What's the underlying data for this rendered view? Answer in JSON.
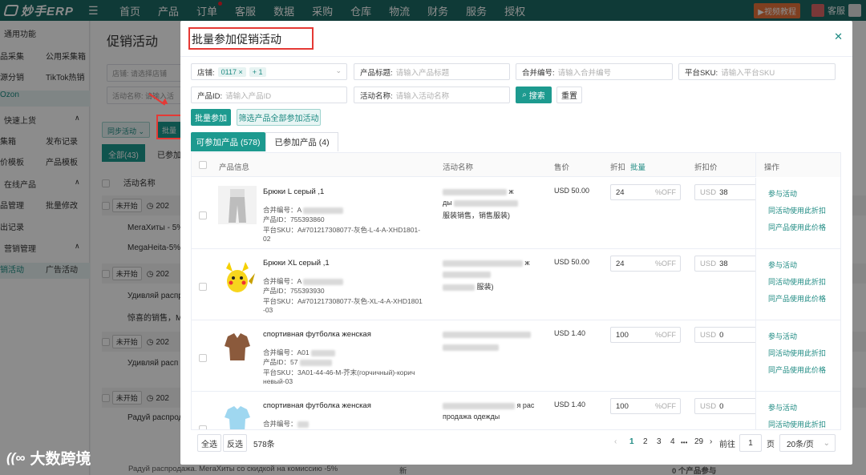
{
  "nav": {
    "logo": "妙手ERP",
    "items": [
      "首页",
      "产品",
      "订单",
      "客服",
      "数据",
      "采购",
      "仓库",
      "物流",
      "财务",
      "服务",
      "授权"
    ],
    "tutorial": "视频教程",
    "service": "客服"
  },
  "sidebar": {
    "rows": [
      {
        "a": "通用功能",
        "b": ""
      },
      {
        "a": "品采集",
        "b": "公用采集箱"
      },
      {
        "a": "源分销",
        "b": "TikTok热销"
      },
      {
        "a": "Ozon",
        "b": ""
      },
      {
        "a": "快速上货",
        "b": ""
      },
      {
        "a": "集箱",
        "b": "发布记录"
      },
      {
        "a": "价模板",
        "b": "产品模板"
      },
      {
        "a": "在线产品",
        "b": ""
      },
      {
        "a": "品管理",
        "b": "批量修改"
      },
      {
        "a": "出记录",
        "b": ""
      },
      {
        "a": "营销管理",
        "b": ""
      },
      {
        "a": "销活动",
        "b": "广告活动"
      }
    ]
  },
  "bg": {
    "title": "促销活动",
    "filter_store": "店铺: 请选择店铺",
    "filter_activity": "活动名称: 请输入活",
    "sync_btn": "同步活动",
    "batch_btn": "批量",
    "tab_all": "全部(43)",
    "tab_joined": "已参加",
    "col_name": "活动名称",
    "status": "未开始",
    "date_prefix": "202",
    "rows": [
      "MeraХиты - 5%",
      "MegaHeita-5%",
      "Удивляй распр",
      "惊喜的销售，M",
      "Удивляй расп",
      "Радуй распрод"
    ],
    "bottom_row": "Радуй распродажа. MeraХиты со скидкой на комиссию -5%",
    "bottom_mid": "新",
    "bottom_right": "0 个产品参与"
  },
  "modal": {
    "title": "批量参加促销活动",
    "filters": {
      "store_label": "店铺:",
      "store_tag1": "0117 ×",
      "store_tag2": "+ 1",
      "title_label": "产品标题:",
      "title_ph": "请输入产品标题",
      "merge_label": "合并编号:",
      "merge_ph": "请输入合并编号",
      "sku_label": "平台SKU:",
      "sku_ph": "请输入平台SKU",
      "pid_label": "产品ID:",
      "pid_ph": "请输入产品ID",
      "act_label": "活动名称:",
      "act_ph": "请输入活动名称",
      "search_btn": "搜索",
      "reset_btn": "重置"
    },
    "batch_join_btn": "批量参加",
    "filter_join_btn": "筛选产品全部参加活动",
    "tabs": {
      "available": "可参加产品 (578)",
      "joined": "已参加产品 (4)"
    },
    "columns": {
      "info": "产品信息",
      "activity": "活动名称",
      "price": "售价",
      "discount": "折扣",
      "batch": "批量",
      "disc_price": "折扣价",
      "ops": "操作"
    },
    "labels": {
      "merge": "合并编号：",
      "pid": "产品ID：",
      "sku": "平台SKU：",
      "off": "%OFF",
      "usd": "USD"
    },
    "ops": {
      "join": "参与活动",
      "same_discount": "同活动使用此折扣",
      "same_price": "同产品使用此价格"
    },
    "rows": [
      {
        "name": "Брюки L серый ,1",
        "merge": "A",
        "pid": "755393860",
        "sku1": "A#701217308077-灰色-L-4-A-XHD1801-",
        "sku2": "02",
        "act1": "ж",
        "act2": "ды",
        "act3": "服装销售，销售服装)",
        "price": "USD 50.00",
        "discount": "24",
        "disc_price": "38"
      },
      {
        "name": "Брюки XL серый ,1",
        "merge": "A",
        "pid": "755393930",
        "sku1": "A#701217308077-灰色-XL-4-A-XHD1801",
        "sku2": "-03",
        "act1": "ж",
        "act2": "",
        "act3": "服装)",
        "price": "USD 50.00",
        "discount": "24",
        "disc_price": "38"
      },
      {
        "name": "спортивная футболка женская",
        "merge": "A01",
        "pid": "57",
        "sku1": "3A01-44-46-M-芥末(горчичный)-корич",
        "sku2": "невый-03",
        "act1": "",
        "act2": "",
        "act3": "",
        "price": "USD 1.40",
        "discount": "100",
        "disc_price": "0"
      },
      {
        "name": "спортивная футболка женская",
        "merge": "",
        "pid": "",
        "sku1": "",
        "sku2": "",
        "act1": "я рас",
        "act2": "продажа одежды",
        "act3": "",
        "price": "USD 1.40",
        "discount": "100",
        "disc_price": "0"
      }
    ],
    "footer": {
      "select_all": "全选",
      "invert": "反选",
      "count": "578条",
      "pages": [
        "1",
        "2",
        "3",
        "4",
        "•••",
        "29"
      ],
      "prev": "‹",
      "next": "›",
      "goto": "前往",
      "page_val": "1",
      "page_unit": "页",
      "per_page": "20条/页"
    }
  },
  "watermark": "大数跨境"
}
